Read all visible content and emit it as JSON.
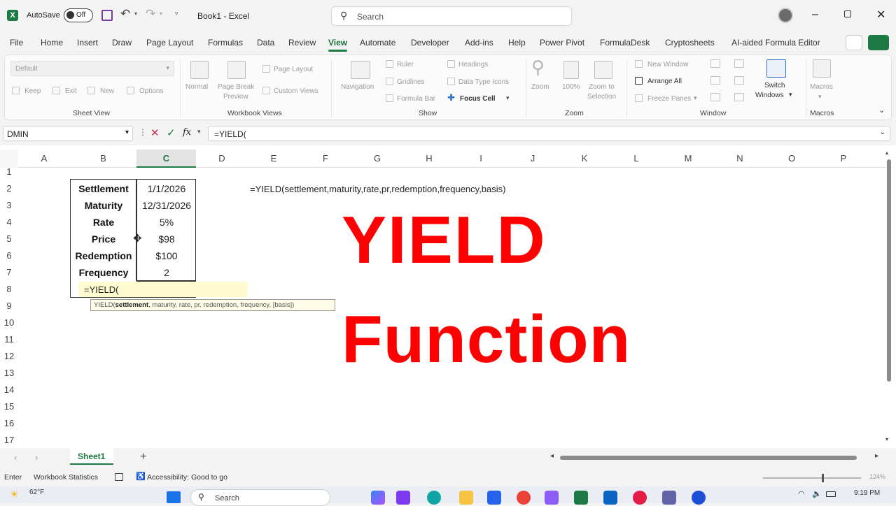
{
  "titlebar": {
    "autosave_label": "AutoSave",
    "autosave_state": "Off",
    "document_title": "Book1 - Excel",
    "search_placeholder": "Search"
  },
  "menu": {
    "items": [
      "File",
      "Home",
      "Insert",
      "Draw",
      "Page Layout",
      "Formulas",
      "Data",
      "Review",
      "View",
      "Automate",
      "Developer",
      "Add-ins",
      "Help",
      "Power Pivot",
      "FormulaDesk",
      "Cryptosheets",
      "AI-aided Formula Editor"
    ],
    "active": "View"
  },
  "ribbon": {
    "sheet_view": {
      "dropdown_value": "Default",
      "keep": "Keep",
      "exit": "Exit",
      "new": "New",
      "options": "Options",
      "label": "Sheet View"
    },
    "workbook_views": {
      "normal": "Normal",
      "page_break_1": "Page Break",
      "page_break_2": "Preview",
      "page_layout": "Page Layout",
      "custom_views": "Custom Views",
      "label": "Workbook Views"
    },
    "show": {
      "navigation": "Navigation",
      "ruler": "Ruler",
      "gridlines": "Gridlines",
      "formula_bar": "Formula Bar",
      "headings": "Headings",
      "data_type_icons": "Data Type Icons",
      "focus_cell": "Focus Cell",
      "label": "Show"
    },
    "zoom": {
      "zoom": "Zoom",
      "hundred": "100%",
      "zoom_to_1": "Zoom to",
      "zoom_to_2": "Selection",
      "label": "Zoom"
    },
    "window": {
      "new_window": "New Window",
      "arrange_all": "Arrange All",
      "freeze_panes": "Freeze Panes",
      "switch_1": "Switch",
      "switch_2": "Windows",
      "label": "Window"
    },
    "macros": {
      "macros": "Macros",
      "label": "Macros"
    }
  },
  "formula_bar": {
    "name_box": "DMIN",
    "fx": "fx",
    "content": "=YIELD("
  },
  "columns": [
    "A",
    "B",
    "C",
    "D",
    "E",
    "F",
    "G",
    "H",
    "I",
    "J",
    "K",
    "L",
    "M",
    "N",
    "O",
    "P"
  ],
  "rows": [
    "1",
    "2",
    "3",
    "4",
    "5",
    "6",
    "7",
    "8",
    "9",
    "10",
    "11",
    "12",
    "13",
    "14",
    "15",
    "16",
    "17"
  ],
  "table": {
    "labels": [
      "Settlement",
      "Maturity",
      "Rate",
      "Price",
      "Redemption",
      "Frequency"
    ],
    "values": [
      "1/1/2026",
      "12/31/2026",
      "5%",
      "$98",
      "$100",
      "2"
    ]
  },
  "active_cell_text": "=YIELD(",
  "tooltip": {
    "prefix": "YIELD(",
    "bold_arg": "settlement",
    "rest": ", maturity, rate, pr, redemption, frequency, [basis])"
  },
  "syntax_note": "=YIELD(settlement,maturity,rate,pr,redemption,frequency,basis)",
  "overlay": {
    "line1": "YIELD",
    "line2": "Function",
    "color": "#ff0000"
  },
  "sheet_tabs": {
    "active": "Sheet1",
    "add": "+"
  },
  "status": {
    "mode": "Enter",
    "workbook_statistics": "Workbook Statistics",
    "accessibility": "Accessibility: Good to go",
    "zoom": "124%"
  },
  "taskbar": {
    "temperature": "62°F",
    "search": "Search",
    "time": "9:19 PM"
  },
  "colors": {
    "excel_green": "#1e7a45",
    "accent_red": "#ff0000",
    "tooltip_bg": "#fffde7"
  }
}
